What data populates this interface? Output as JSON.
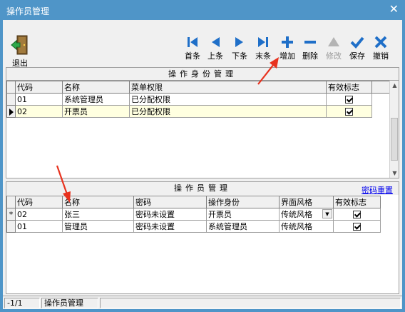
{
  "window": {
    "title": "操作员管理",
    "close_glyph": "✕"
  },
  "toolbar": {
    "exit": {
      "label": "退出",
      "icon": "exit-door-icon"
    },
    "buttons": [
      {
        "label": "首条",
        "icon": "first-icon",
        "enabled": true
      },
      {
        "label": "上条",
        "icon": "prev-icon",
        "enabled": true
      },
      {
        "label": "下条",
        "icon": "next-icon",
        "enabled": true
      },
      {
        "label": "末条",
        "icon": "last-icon",
        "enabled": true
      },
      {
        "label": "增加",
        "icon": "add-icon",
        "enabled": true
      },
      {
        "label": "删除",
        "icon": "delete-icon",
        "enabled": true
      },
      {
        "label": "修改",
        "icon": "edit-icon",
        "enabled": false
      },
      {
        "label": "保存",
        "icon": "save-icon",
        "enabled": true
      },
      {
        "label": "撤销",
        "icon": "undo-icon",
        "enabled": true
      }
    ],
    "accent": "#1f6fc8"
  },
  "roles_panel": {
    "title": "操作身份管理",
    "columns": [
      "代码",
      "名称",
      "菜单权限",
      "有效标志"
    ],
    "rows": [
      {
        "code": "01",
        "name": "系统管理员",
        "perm": "已分配权限",
        "valid": true,
        "current": false
      },
      {
        "code": "02",
        "name": "开票员",
        "perm": "已分配权限",
        "valid": true,
        "current": true
      }
    ]
  },
  "operators_panel": {
    "title": "操作员管理",
    "reset_link": "密码重置",
    "columns": [
      "代码",
      "名称",
      "密码",
      "操作身份",
      "界面风格",
      "有效标志"
    ],
    "rows": [
      {
        "marker": "*",
        "code": "02",
        "name": "张三",
        "password": "密码未设置",
        "role": "开票员",
        "style": "传统风格",
        "valid": true,
        "editing": true
      },
      {
        "marker": "",
        "code": "01",
        "name": "管理员",
        "password": "密码未设置",
        "role": "系统管理员",
        "style": "传统风格",
        "valid": true,
        "editing": false
      }
    ]
  },
  "status_bar": {
    "position": "-1/1",
    "module": "操作员管理"
  }
}
